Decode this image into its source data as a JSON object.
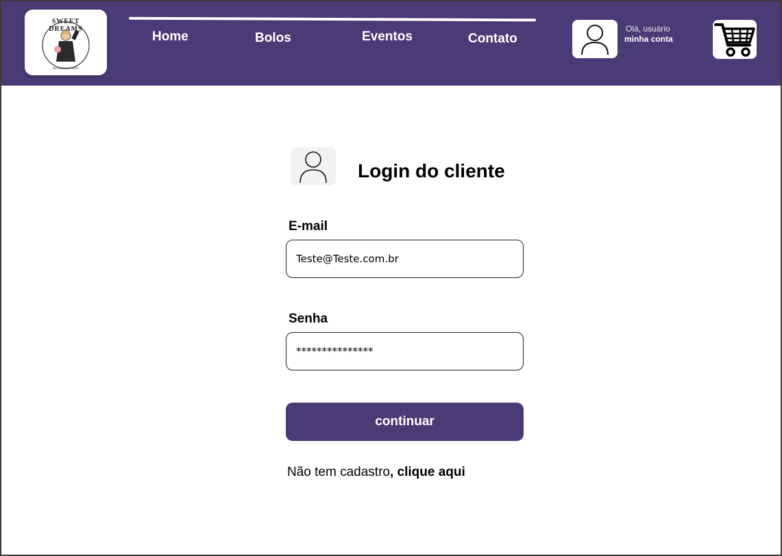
{
  "header": {
    "logo": {
      "text": "SWEET DREAMS",
      "subtext": "BRAZILIAN BAKERY"
    },
    "nav": [
      {
        "label": "Home"
      },
      {
        "label": "Bolos"
      },
      {
        "label": "Eventos"
      },
      {
        "label": "Contato"
      }
    ],
    "account": {
      "greeting": "Olá, usuário",
      "link": "minha conta",
      "icon": "user-icon"
    },
    "cart_icon": "cart-icon"
  },
  "login": {
    "title": "Login do cliente",
    "email_label": "E-mail",
    "email_value": "Teste@Teste.com.br",
    "password_label": "Senha",
    "password_value": "***************",
    "submit_label": "continuar",
    "signup_text": "Não tem cadastro",
    "signup_link": ", clique aqui"
  },
  "colors": {
    "brand": "#4a3b76",
    "background": "#ffffff"
  }
}
